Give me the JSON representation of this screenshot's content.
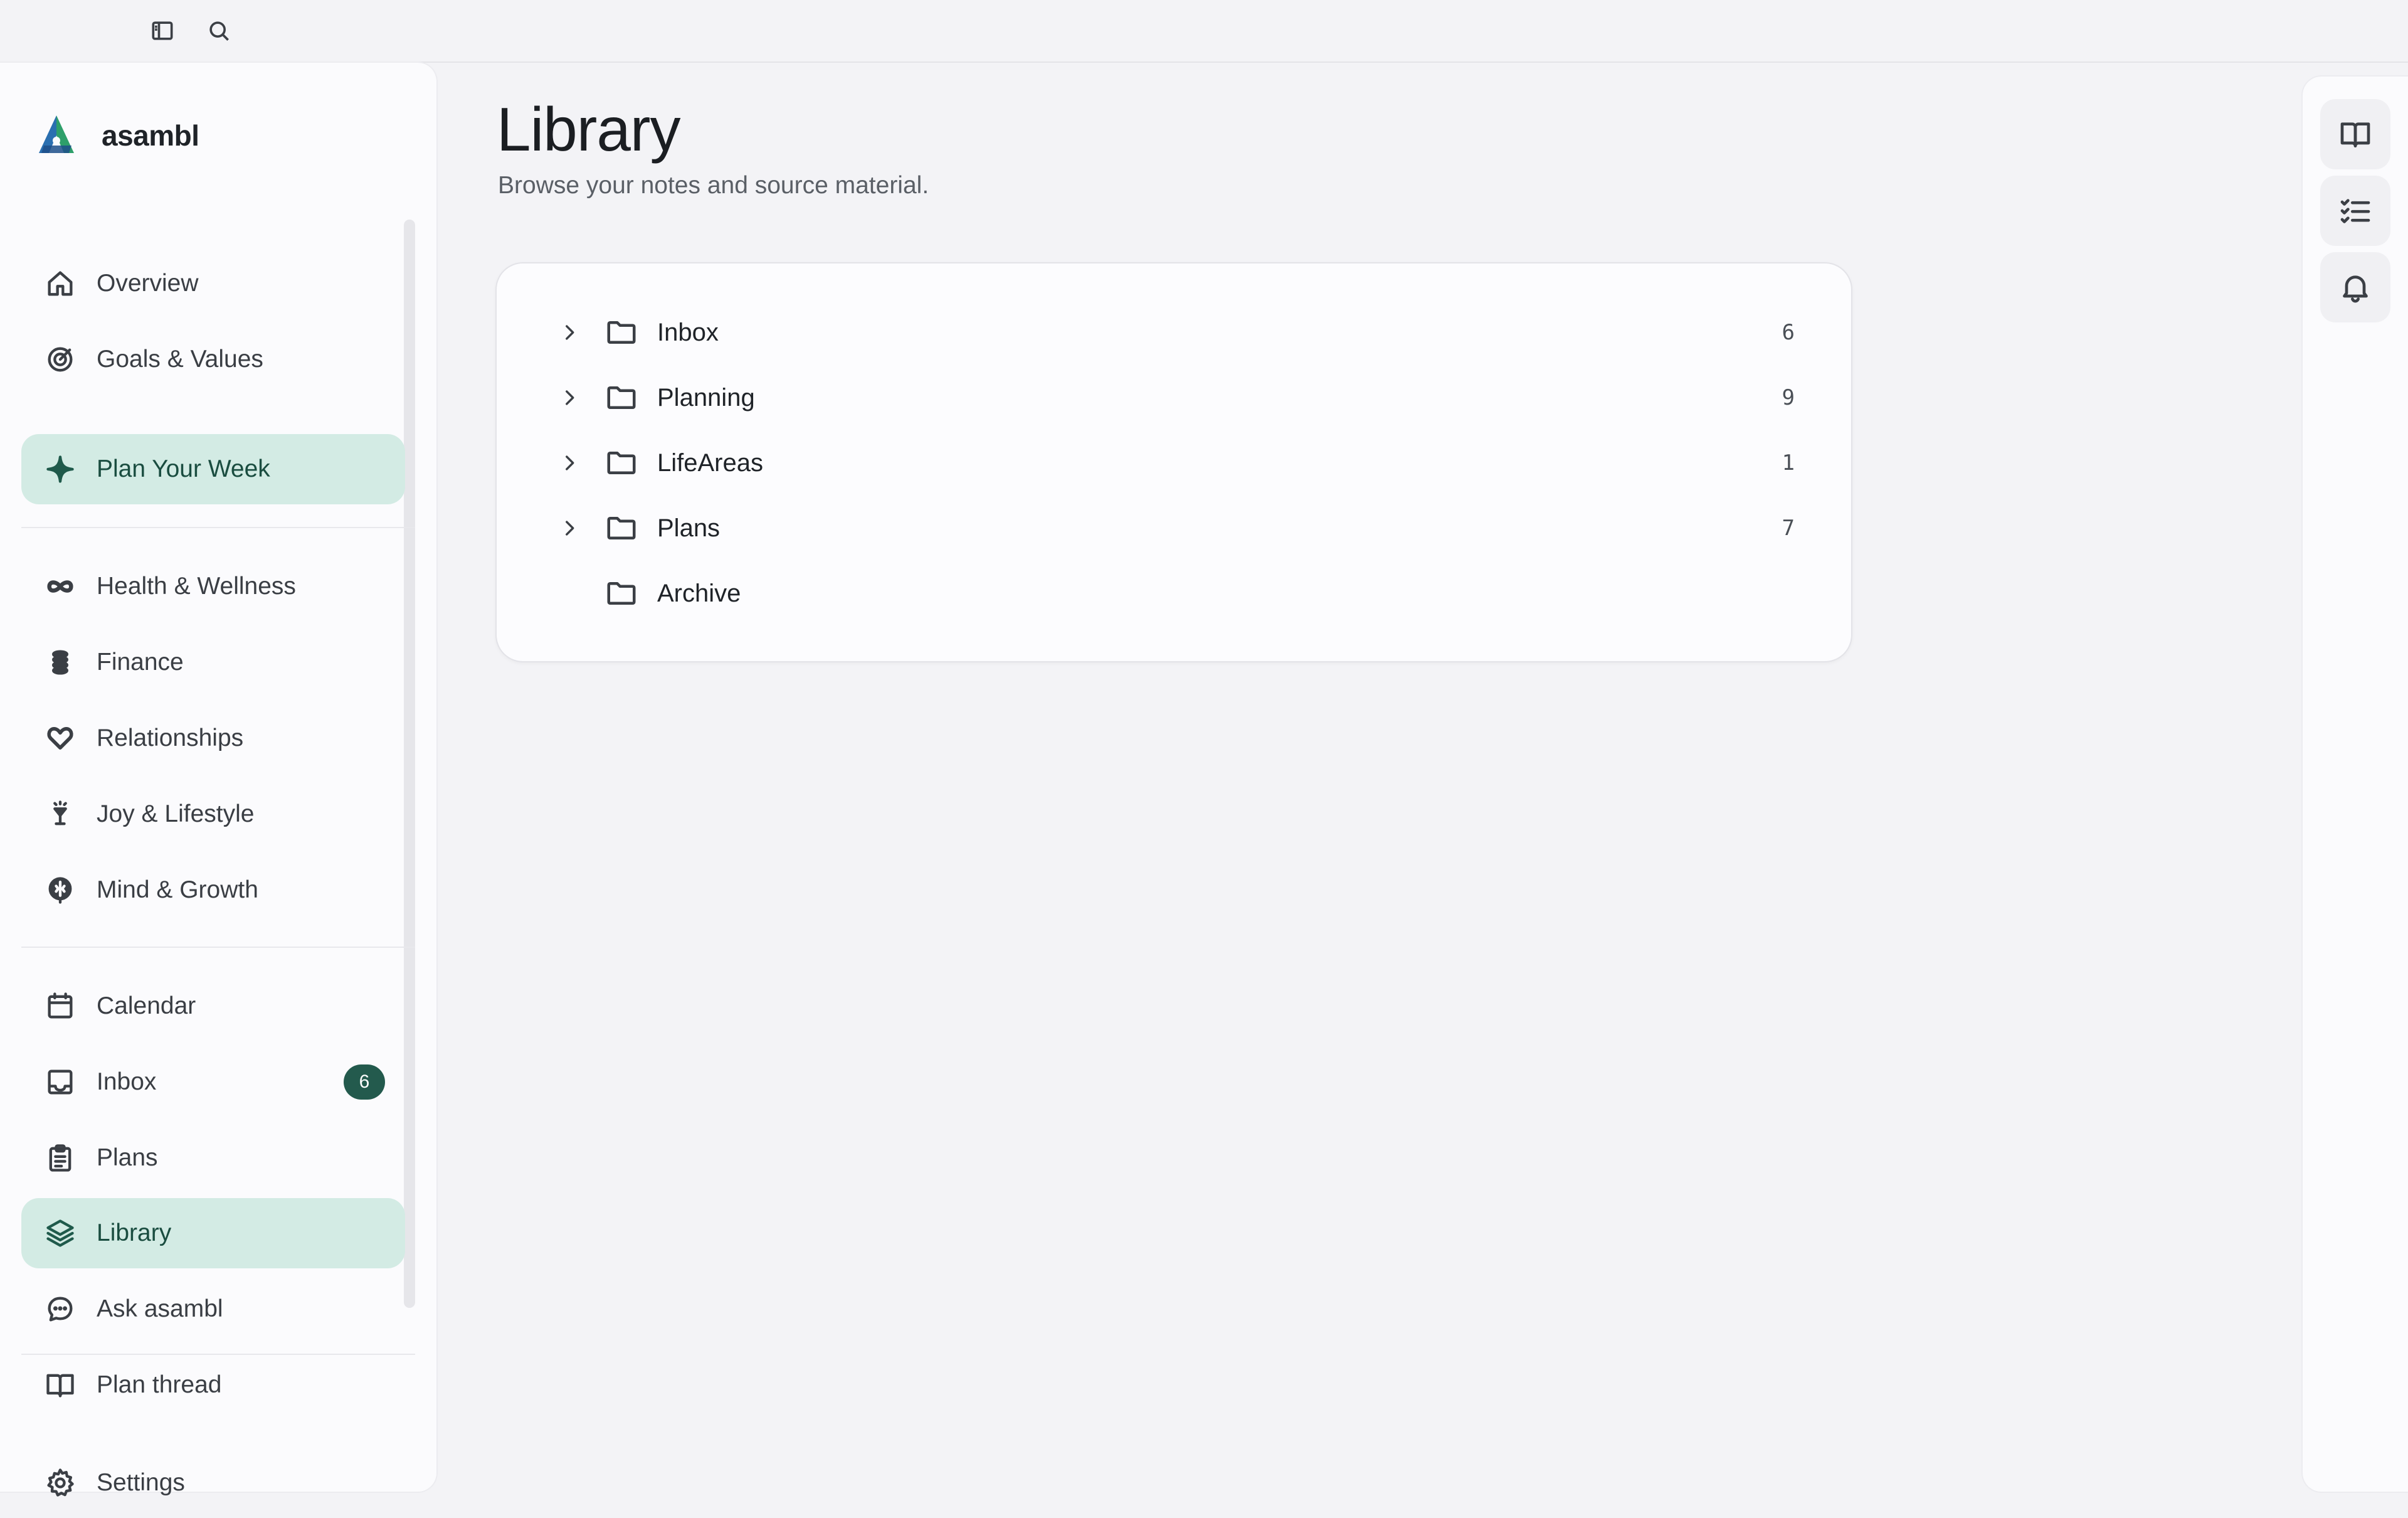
{
  "brand": {
    "name": "asambl"
  },
  "sidebar": {
    "primary": [
      {
        "label": "Overview",
        "icon": "home-icon"
      },
      {
        "label": "Goals & Values",
        "icon": "target-icon"
      },
      {
        "label": "Plan Your Week",
        "icon": "sparkle-icon",
        "active": true
      }
    ],
    "areas": [
      {
        "label": "Health & Wellness",
        "icon": "infinity-icon"
      },
      {
        "label": "Finance",
        "icon": "coins-icon"
      },
      {
        "label": "Relationships",
        "icon": "heart-icon"
      },
      {
        "label": "Joy & Lifestyle",
        "icon": "glass-icon"
      },
      {
        "label": "Mind & Growth",
        "icon": "brain-icon"
      }
    ],
    "tools": [
      {
        "label": "Calendar",
        "icon": "calendar-icon"
      },
      {
        "label": "Inbox",
        "icon": "inbox-icon",
        "badge": "6"
      },
      {
        "label": "Plans",
        "icon": "clipboard-icon"
      },
      {
        "label": "Library",
        "icon": "layers-icon",
        "active": true
      },
      {
        "label": "Ask asambl",
        "icon": "chat-icon"
      },
      {
        "label": "Plan thread",
        "icon": "book-icon"
      }
    ],
    "footer": {
      "label": "Settings",
      "icon": "gear-icon"
    }
  },
  "main": {
    "title": "Library",
    "subtitle": "Browse your notes and source material.",
    "folders": [
      {
        "name": "Inbox",
        "count": "6",
        "expandable": true
      },
      {
        "name": "Planning",
        "count": "9",
        "expandable": true
      },
      {
        "name": "LifeAreas",
        "count": "1",
        "expandable": true
      },
      {
        "name": "Plans",
        "count": "7",
        "expandable": true
      },
      {
        "name": "Archive",
        "count": "",
        "expandable": false
      }
    ]
  },
  "right_rail": {
    "buttons": [
      "book-open-icon",
      "checklist-icon",
      "bell-icon"
    ]
  },
  "colors": {
    "accent": "#235a4d",
    "active_bg": "#d3ebe4",
    "background": "#f3f3f6"
  }
}
